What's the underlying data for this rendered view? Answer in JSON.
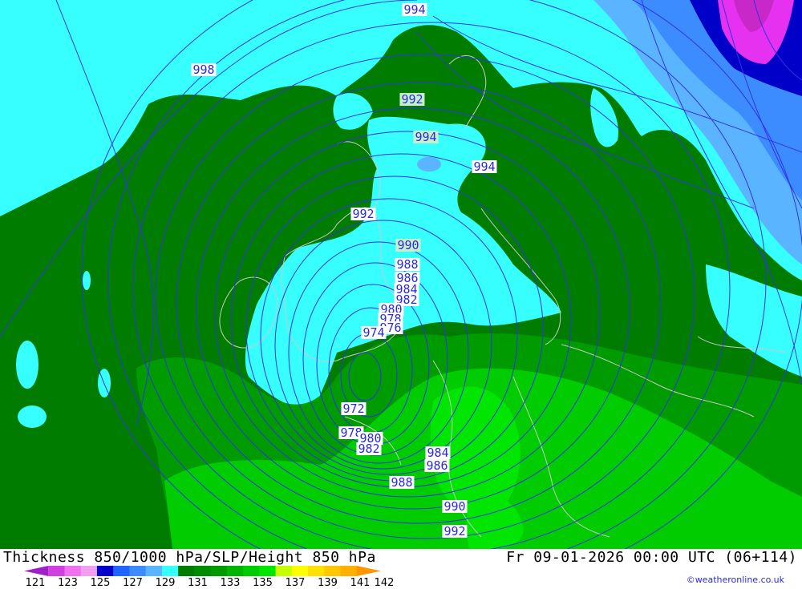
{
  "map": {
    "title": "Thickness 850/1000 hPa/SLP/Height 850 hPa",
    "valid_time": "Fr 09-01-2026 00:00 UTC (06+114)",
    "credit": "©weatheronline.co.uk",
    "colors": {
      "cyan": "#38ffff",
      "dark_green": "#007d00",
      "mid_green": "#009b00",
      "bright_green": "#00cc00",
      "lime": "#00e600",
      "light_blue": "#5ab4ff",
      "blue": "#1e64ff",
      "dark_blue": "#0000c8",
      "magenta": "#e632f0",
      "isobar": "#3232e6",
      "coast": "#c8c8c8"
    },
    "legend": {
      "ticks": [
        "121",
        "123",
        "125",
        "127",
        "129",
        "131",
        "133",
        "135",
        "137",
        "139",
        "141",
        "142"
      ],
      "colors": [
        "#a020c8",
        "#d040e0",
        "#f070f0",
        "#f0a0f0",
        "#0000c8",
        "#1e64ff",
        "#3c8cff",
        "#5ab4ff",
        "#38ffff",
        "#007d00",
        "#008c00",
        "#009b00",
        "#00b400",
        "#00cc00",
        "#00e600",
        "#c8ff00",
        "#ffff00",
        "#ffe000",
        "#ffc800",
        "#ffb000",
        "#ff9600"
      ]
    },
    "isobar_labels": [
      {
        "value": "994"
      },
      {
        "value": "998"
      },
      {
        "value": "992"
      },
      {
        "value": "994"
      },
      {
        "value": "994"
      },
      {
        "value": "992"
      },
      {
        "value": "990"
      },
      {
        "value": "988"
      },
      {
        "value": "986"
      },
      {
        "value": "984"
      },
      {
        "value": "982"
      },
      {
        "value": "980"
      },
      {
        "value": "978"
      },
      {
        "value": "976"
      },
      {
        "value": "974"
      },
      {
        "value": "972"
      },
      {
        "value": "978"
      },
      {
        "value": "980"
      },
      {
        "value": "982"
      },
      {
        "value": "984"
      },
      {
        "value": "986"
      },
      {
        "value": "988"
      },
      {
        "value": "990"
      },
      {
        "value": "992"
      }
    ]
  }
}
